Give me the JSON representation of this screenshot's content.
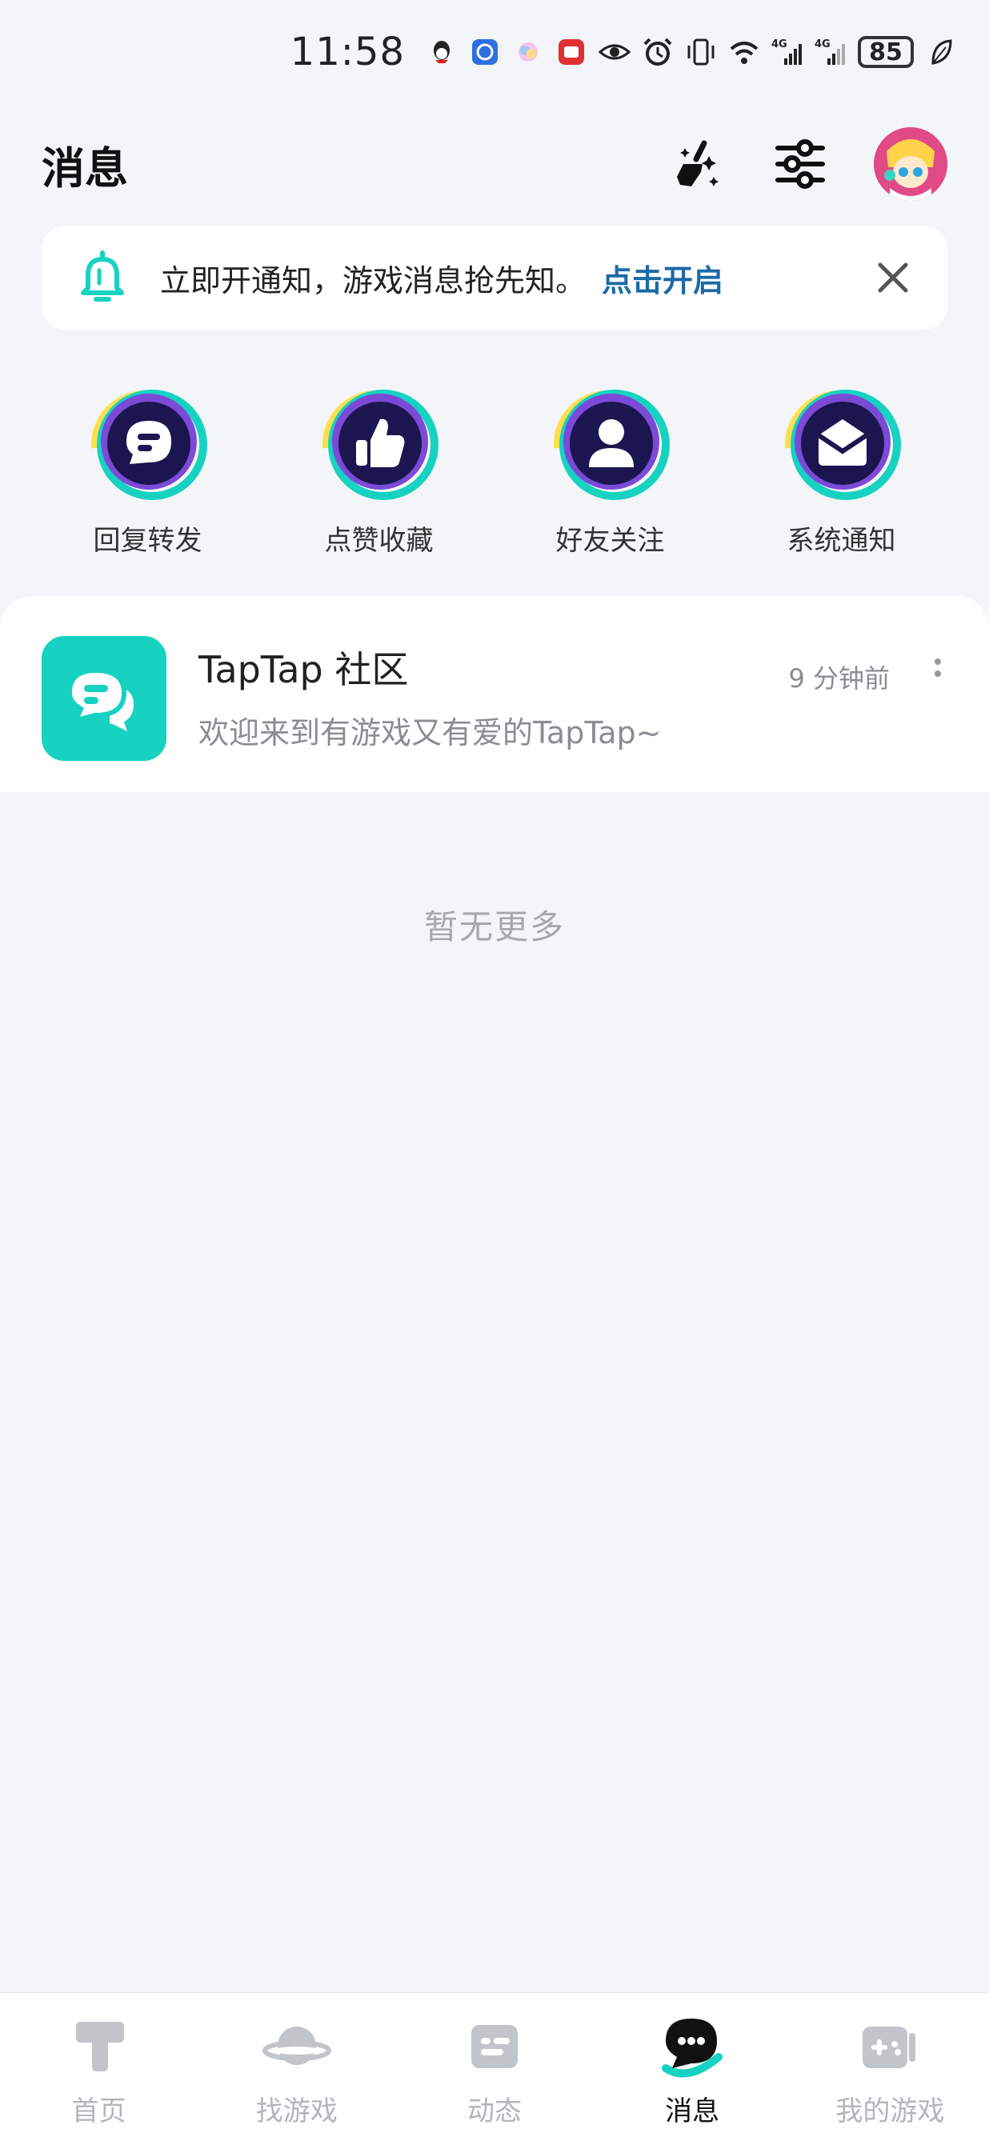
{
  "status_bar": {
    "time": "11:58",
    "battery": "85",
    "icons": [
      "qq-icon",
      "app-icon",
      "photo-icon",
      "red-app-icon",
      "eye-icon",
      "alarm-icon",
      "vibrate-icon",
      "wifi-icon",
      "signal-4g-icon",
      "signal-4g-icon",
      "battery-icon",
      "leaf-icon"
    ]
  },
  "header": {
    "title": "消息",
    "actions": [
      "clean-icon",
      "settings-sliders-icon",
      "avatar"
    ]
  },
  "notice": {
    "text": "立即开通知，游戏消息抢先知。",
    "link": "点击开启"
  },
  "categories": [
    {
      "label": "回复转发",
      "icon": "chat-bubble-icon"
    },
    {
      "label": "点赞收藏",
      "icon": "thumbs-up-icon"
    },
    {
      "label": "好友关注",
      "icon": "person-icon"
    },
    {
      "label": "系统通知",
      "icon": "envelope-icon"
    }
  ],
  "messages": [
    {
      "title": "TapTap 社区",
      "preview": "欢迎来到有游戏又有爱的TapTap~",
      "time": "9 分钟前"
    }
  ],
  "empty_hint": "暂无更多",
  "bottom_nav": [
    {
      "label": "首页",
      "icon": "home-t-icon",
      "active": false
    },
    {
      "label": "找游戏",
      "icon": "planet-icon",
      "active": false
    },
    {
      "label": "动态",
      "icon": "feed-icon",
      "active": false
    },
    {
      "label": "消息",
      "icon": "message-icon",
      "active": true
    },
    {
      "label": "我的游戏",
      "icon": "gamepad-icon",
      "active": false
    }
  ],
  "colors": {
    "accent": "#17d2c1",
    "link": "#1a6aa6",
    "category_bg": "#1b1650",
    "category_ring": "#7b4ad6"
  }
}
